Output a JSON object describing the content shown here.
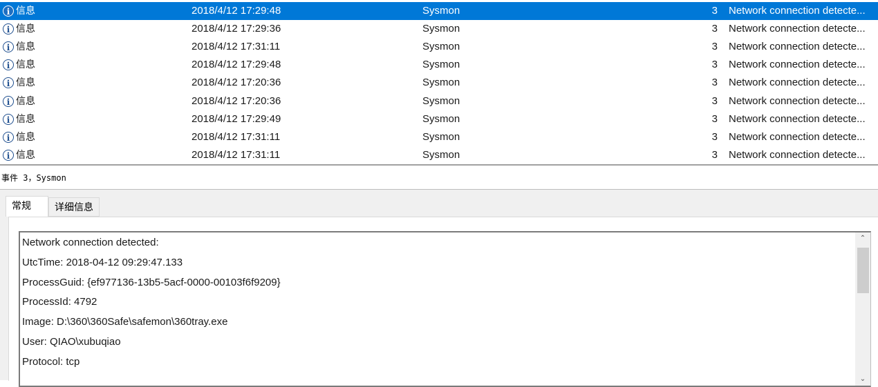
{
  "event_list": {
    "rows": [
      {
        "level": "信息",
        "date": "2018/4/12 17:29:48",
        "source": "Sysmon",
        "event_id": "3",
        "task": "Network connection detecte...",
        "selected": true
      },
      {
        "level": "信息",
        "date": "2018/4/12 17:29:36",
        "source": "Sysmon",
        "event_id": "3",
        "task": "Network connection detecte...",
        "selected": false
      },
      {
        "level": "信息",
        "date": "2018/4/12 17:31:11",
        "source": "Sysmon",
        "event_id": "3",
        "task": "Network connection detecte...",
        "selected": false
      },
      {
        "level": "信息",
        "date": "2018/4/12 17:29:48",
        "source": "Sysmon",
        "event_id": "3",
        "task": "Network connection detecte...",
        "selected": false
      },
      {
        "level": "信息",
        "date": "2018/4/12 17:20:36",
        "source": "Sysmon",
        "event_id": "3",
        "task": "Network connection detecte...",
        "selected": false
      },
      {
        "level": "信息",
        "date": "2018/4/12 17:20:36",
        "source": "Sysmon",
        "event_id": "3",
        "task": "Network connection detecte...",
        "selected": false
      },
      {
        "level": "信息",
        "date": "2018/4/12 17:29:49",
        "source": "Sysmon",
        "event_id": "3",
        "task": "Network connection detecte...",
        "selected": false
      },
      {
        "level": "信息",
        "date": "2018/4/12 17:31:11",
        "source": "Sysmon",
        "event_id": "3",
        "task": "Network connection detecte...",
        "selected": false
      },
      {
        "level": "信息",
        "date": "2018/4/12 17:31:11",
        "source": "Sysmon",
        "event_id": "3",
        "task": "Network connection detecte...",
        "selected": false
      }
    ],
    "level_icon": "info-icon",
    "selection_color": "#0078d7"
  },
  "event_header": {
    "title": "事件 3，Sysmon"
  },
  "tabs": [
    {
      "label": "常规",
      "active": true
    },
    {
      "label": "详细信息",
      "active": false
    }
  ],
  "details": {
    "lines": [
      "Network connection detected:",
      "UtcTime: 2018-04-12 09:29:47.133",
      "ProcessGuid: {ef977136-13b5-5acf-0000-00103f6f9209}",
      "ProcessId: 4792",
      "Image: D:\\360\\360Safe\\safemon\\360tray.exe",
      "User: QIAO\\xubuqiao",
      "Protocol: tcp"
    ]
  }
}
